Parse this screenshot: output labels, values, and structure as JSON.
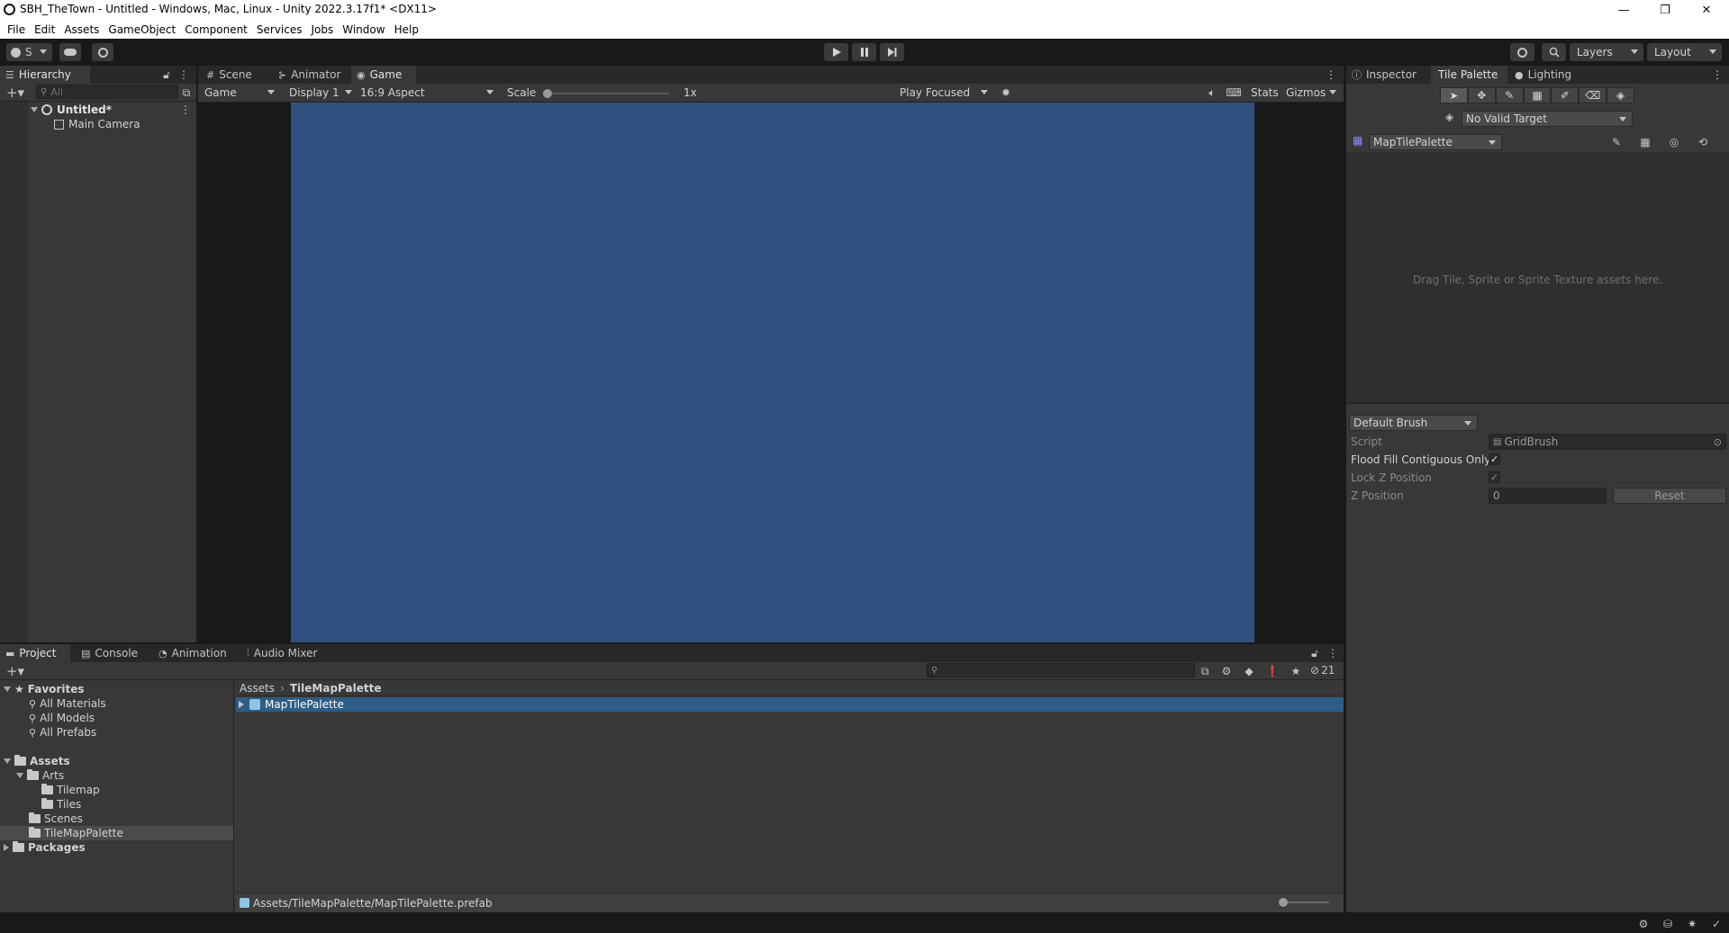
{
  "window": {
    "title": "SBH_TheTown - Untitled - Windows, Mac, Linux - Unity 2022.3.17f1* <DX11>",
    "controls": {
      "minimize": "—",
      "restore": "❐",
      "close": "✕"
    }
  },
  "menu": [
    "File",
    "Edit",
    "Assets",
    "GameObject",
    "Component",
    "Services",
    "Jobs",
    "Window",
    "Help"
  ],
  "toolbar": {
    "account_label": "S",
    "layers_label": "Layers",
    "layout_label": "Layout"
  },
  "hierarchy": {
    "tab_label": "Hierarchy",
    "search_placeholder": "All",
    "scene_name": "Untitled*",
    "items": [
      "Main Camera"
    ]
  },
  "center_tabs": [
    "Scene",
    "Animator",
    "Game"
  ],
  "game_toolbar": {
    "view": "Game",
    "display": "Display 1",
    "aspect": "16:9 Aspect",
    "scale_label": "Scale",
    "scale_value": "1x",
    "scale_level": 0,
    "play_mode": "Play Focused",
    "stats": "Stats",
    "gizmos": "Gizmos"
  },
  "colors": {
    "game_view_bg": "#30517f",
    "selection": "#2c5d87",
    "panel": "#383838",
    "toolbar": "#191919"
  },
  "right_tabs": [
    "Inspector",
    "Tile Palette",
    "Lighting"
  ],
  "tile_palette": {
    "target": "No Valid Target",
    "palette": "MapTilePalette",
    "drop_hint": "Drag Tile, Sprite or Sprite Texture assets here.",
    "brush": "Default Brush",
    "props": {
      "script_label": "Script",
      "script_value": "GridBrush",
      "flood_label": "Flood Fill Contiguous Only",
      "flood_checked": true,
      "lockz_label": "Lock Z Position",
      "lockz_checked": true,
      "zpos_label": "Z Position",
      "zpos_value": "0",
      "reset_label": "Reset"
    }
  },
  "bottom_tabs": [
    "Project",
    "Console",
    "Animation",
    "Audio Mixer"
  ],
  "project": {
    "hidden_count": "21",
    "favorites_label": "Favorites",
    "favorites": [
      "All Materials",
      "All Models",
      "All Prefabs"
    ],
    "assets_label": "Assets",
    "arts_label": "Arts",
    "arts_children": [
      "Tilemap",
      "Tiles"
    ],
    "scenes_label": "Scenes",
    "tilemappalette_label": "TileMapPalette",
    "packages_label": "Packages",
    "breadcrumb_root": "Assets",
    "breadcrumb_current": "TileMapPalette",
    "selected_asset": "MapTilePalette",
    "status_path": "Assets/TileMapPalette/MapTilePalette.prefab",
    "zoom_level": 0
  }
}
